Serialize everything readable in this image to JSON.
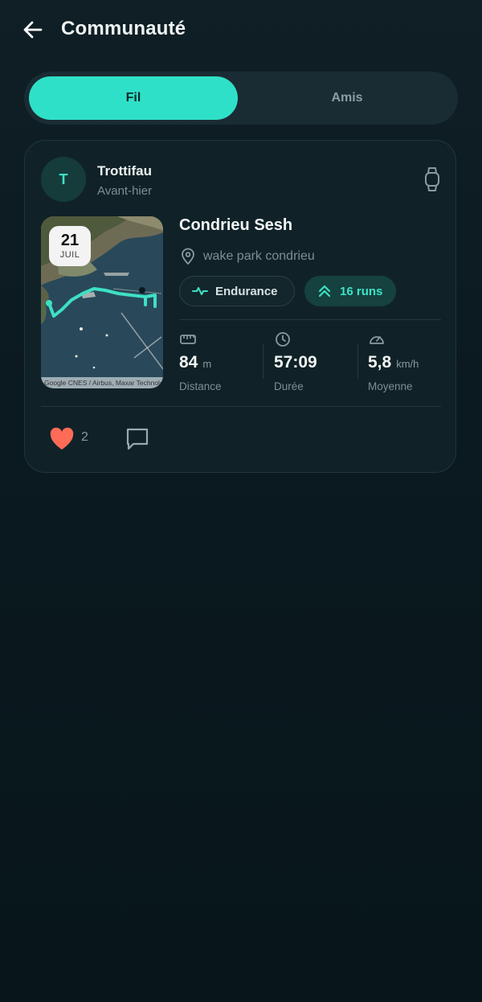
{
  "header": {
    "title": "Communauté",
    "back_icon": "arrow-left-icon"
  },
  "tabs": [
    {
      "label": "Fil",
      "active": true
    },
    {
      "label": "Amis",
      "active": false
    }
  ],
  "colors": {
    "accent": "#2fe0c8",
    "background": "#0b1a20",
    "card": "#102228",
    "like": "#ff6b57"
  },
  "post": {
    "avatar_letter": "T",
    "username": "Trottifau",
    "when": "Avant-hier",
    "device_icon": "watch-icon",
    "map": {
      "day": "21",
      "month": "JUIL",
      "credit": "Google CNES / Airbus, Maxar Technologies"
    },
    "activity_title": "Condrieu Sesh",
    "location": "wake park condrieu",
    "chips": {
      "type": "Endurance",
      "runs": "16 runs"
    },
    "stats": {
      "distance": {
        "value": "84",
        "unit": "m",
        "label": "Distance"
      },
      "duration": {
        "value": "57:09",
        "label": "Durée"
      },
      "average": {
        "value": "5,8",
        "unit": "km/h",
        "label": "Moyenne"
      }
    },
    "likes": "2"
  }
}
